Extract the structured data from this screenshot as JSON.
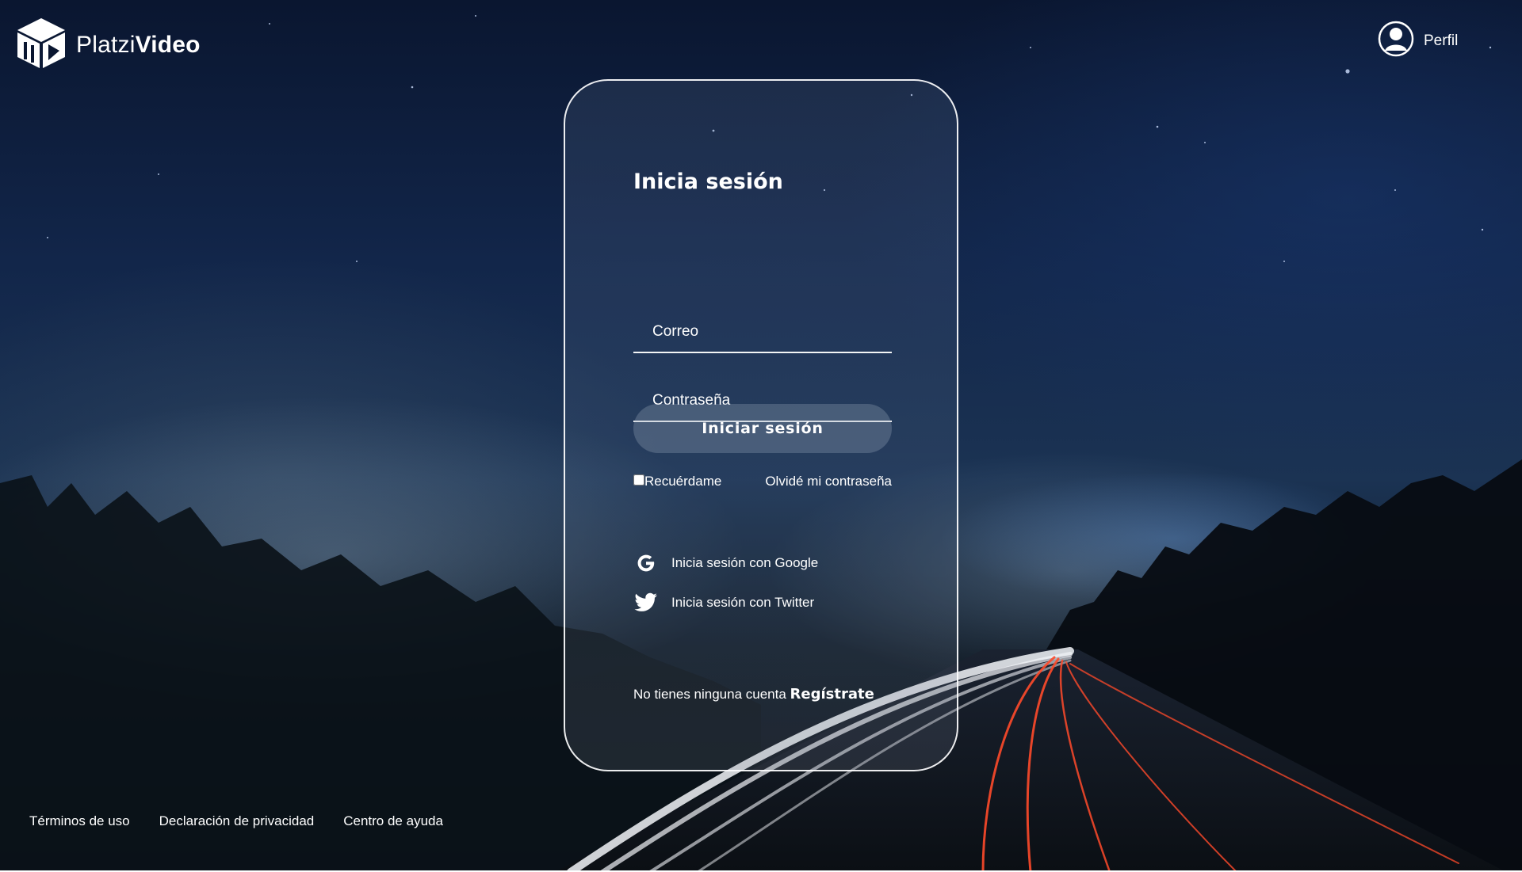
{
  "header": {
    "brand_light": "Platzi",
    "brand_bold": "Video",
    "profile_label": "Perfil",
    "logo_icon": "cube-play-logo-icon",
    "profile_icon": "user-avatar-icon"
  },
  "login": {
    "title": "Inicia sesión",
    "email_placeholder": "Correo",
    "password_placeholder": "Contraseña",
    "submit_label": "Iniciar sesión",
    "remember_label": "Recuérdame",
    "remember_checked": false,
    "forgot_label": "Olvidé mi contraseña",
    "google_label": "Inicia sesión con Google",
    "twitter_label": "Inicia sesión con Twitter",
    "google_icon": "google-icon",
    "twitter_icon": "twitter-bird-icon",
    "no_account_text": "No tienes ninguna cuenta",
    "register_label": "Regístrate"
  },
  "footer": {
    "terms": "Términos de uso",
    "privacy": "Declaración de privacidad",
    "help": "Centro de ayuda"
  },
  "colors": {
    "text": "#ffffff",
    "card_border": "#ffffff",
    "sky_dark": "#0a1630",
    "light_trail_red": "#ff4a2a",
    "light_trail_white": "#f2f4f8"
  }
}
